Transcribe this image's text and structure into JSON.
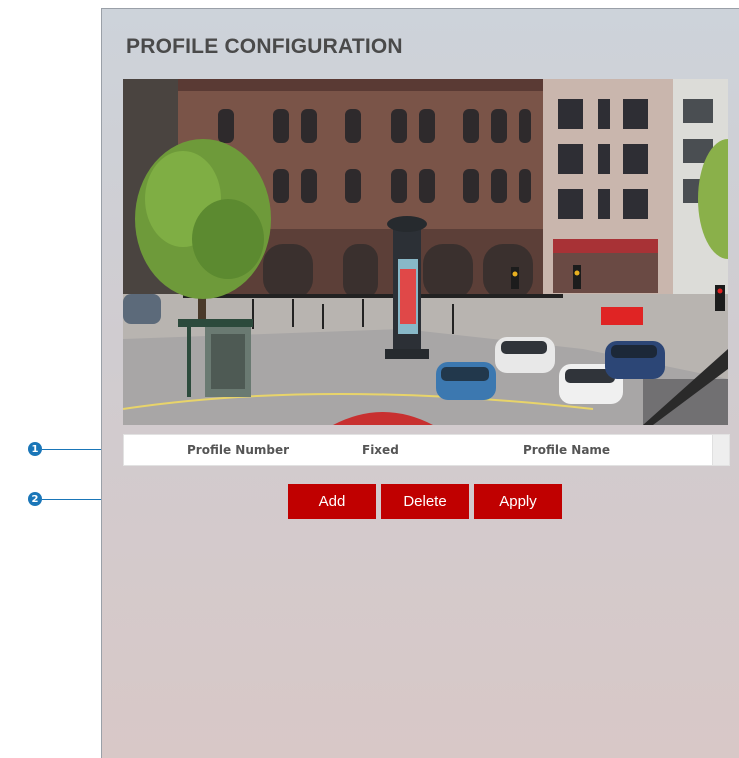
{
  "page": {
    "title": "PROFILE CONFIGURATION"
  },
  "table": {
    "columns": [
      "Profile Number",
      "Fixed",
      "Profile Name"
    ]
  },
  "buttons": {
    "add": "Add",
    "delete": "Delete",
    "apply": "Apply"
  },
  "callouts": [
    "1",
    "2"
  ],
  "colors": {
    "button_red": "#c00000",
    "callout_blue": "#1a76b8",
    "title_gray": "#4a4a4a"
  }
}
